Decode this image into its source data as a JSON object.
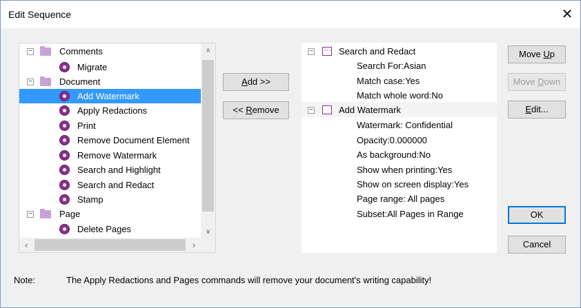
{
  "window": {
    "title": "Edit Sequence",
    "close_glyph": "✕"
  },
  "commands_tree": {
    "rows": [
      {
        "kind": "folder",
        "label": "Comments",
        "expander": "−"
      },
      {
        "kind": "command",
        "label": "Migrate"
      },
      {
        "kind": "folder",
        "label": "Document",
        "expander": "−"
      },
      {
        "kind": "command",
        "label": "Add Watermark",
        "selected": true
      },
      {
        "kind": "command",
        "label": "Apply Redactions"
      },
      {
        "kind": "command",
        "label": "Print"
      },
      {
        "kind": "command",
        "label": "Remove Document Element"
      },
      {
        "kind": "command",
        "label": "Remove Watermark"
      },
      {
        "kind": "command",
        "label": "Search and Highlight"
      },
      {
        "kind": "command",
        "label": "Search and Redact"
      },
      {
        "kind": "command",
        "label": "Stamp"
      },
      {
        "kind": "folder",
        "label": "Page",
        "expander": "−"
      },
      {
        "kind": "command",
        "label": "Delete Pages"
      }
    ]
  },
  "buttons": {
    "add": {
      "accel": "A",
      "rest": "dd >>"
    },
    "remove": {
      "pre": "<< ",
      "accel": "R",
      "rest": "emove"
    },
    "move_up": {
      "pre": "Move ",
      "accel": "U",
      "rest": "p"
    },
    "move_down": {
      "pre": "Move ",
      "accel": "D",
      "rest": "own"
    },
    "edit": {
      "accel": "E",
      "rest": "dit..."
    },
    "ok": "OK",
    "cancel": "Cancel"
  },
  "sequence": {
    "steps": [
      {
        "title": "Search and Redact",
        "expander": "−",
        "details": [
          "Search For:Asian",
          "Match case:Yes",
          "Match whole word:No"
        ]
      },
      {
        "title": "Add Watermark",
        "expander": "−",
        "details": [
          "Watermark: Confidential",
          "Opacity:0.000000",
          "As background:No",
          "Show when printing:Yes",
          "Show on screen display:Yes",
          "Page range: All pages",
          "Subset:All Pages in Range"
        ]
      }
    ]
  },
  "note": {
    "label": "Note:",
    "text": "The Apply Redactions and Pages commands will remove your document's writing capability!"
  }
}
